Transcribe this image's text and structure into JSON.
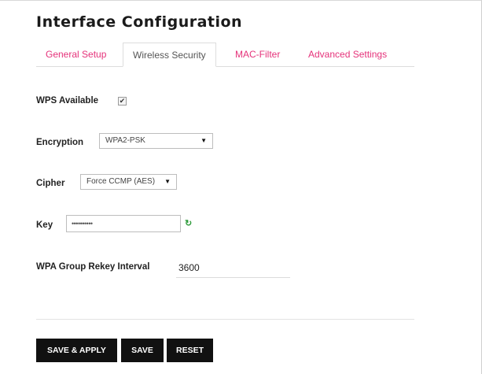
{
  "page": {
    "title": "Interface Configuration"
  },
  "tabs": [
    {
      "label": "General Setup",
      "active": false
    },
    {
      "label": "Wireless Security",
      "active": true
    },
    {
      "label": "MAC-Filter",
      "active": false
    },
    {
      "label": "Advanced Settings",
      "active": false
    }
  ],
  "form": {
    "wps_label": "WPS Available",
    "wps_checked": true,
    "wps_check_glyph": "✔",
    "encryption_label": "Encryption",
    "encryption_value": "WPA2-PSK",
    "cipher_label": "Cipher",
    "cipher_value": "Force CCMP (AES)",
    "dropdown_glyph": "▼",
    "key_label": "Key",
    "key_value": "••••••••••",
    "key_refresh_glyph": "↻",
    "rekey_label": "WPA Group Rekey Interval",
    "rekey_value": "3600"
  },
  "buttons": {
    "save_apply": "SAVE & APPLY",
    "save": "SAVE",
    "reset": "RESET"
  },
  "colors": {
    "tab_link": "#e5327a",
    "tab_active": "#555555",
    "button_bg": "#111111",
    "refresh_icon": "#2e9a3a"
  }
}
